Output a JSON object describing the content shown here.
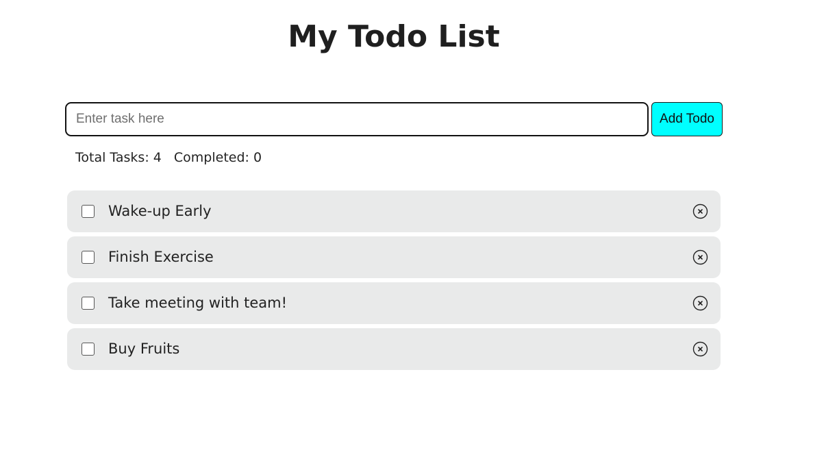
{
  "page": {
    "title": "My Todo List"
  },
  "form": {
    "input_value": "",
    "input_placeholder": "Enter task here",
    "add_button_label": "Add Todo",
    "add_button_color": "#00ffff"
  },
  "stats": {
    "total_label": "Total Tasks: 4",
    "completed_label": "Completed: 0"
  },
  "todos": [
    {
      "label": "Wake-up Early",
      "completed": false,
      "delete_icon": "close-circle-icon"
    },
    {
      "label": "Finish Exercise",
      "completed": false,
      "delete_icon": "close-circle-icon"
    },
    {
      "label": "Take meeting with team!",
      "completed": false,
      "delete_icon": "close-circle-icon"
    },
    {
      "label": "Buy Fruits",
      "completed": false,
      "delete_icon": "close-circle-icon"
    }
  ],
  "colors": {
    "item_background": "#e9eaea",
    "text": "#222222"
  }
}
